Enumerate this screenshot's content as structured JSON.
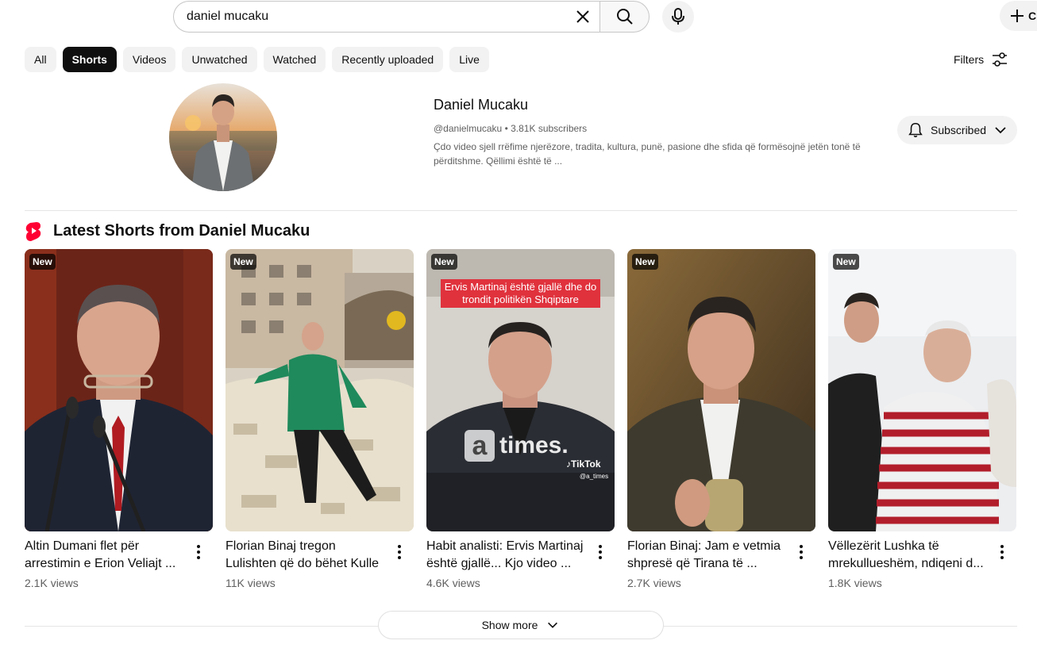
{
  "search": {
    "query": "daniel mucaku",
    "create_label": "C"
  },
  "chips": [
    "All",
    "Shorts",
    "Videos",
    "Unwatched",
    "Watched",
    "Recently uploaded",
    "Live"
  ],
  "active_chip": "Shorts",
  "filters_label": "Filters",
  "channel": {
    "name": "Daniel Mucaku",
    "handle": "@danielmucaku",
    "subscribers": "3.81K subscribers",
    "description": "Çdo video sjell rrëfime njerëzore, tradita, kultura, punë, pasione dhe sfida që formësojnë jetën tonë të përditshme. Qëllimi është të ...",
    "subscribe_label": "Subscribed"
  },
  "shelf": {
    "title": "Latest Shorts from Daniel Mucaku",
    "show_more": "Show more",
    "cards": [
      {
        "badge": "New",
        "title": "Altin Dumani flet për arrestimin e Erion Veliajt ...",
        "views": "2.1K views"
      },
      {
        "badge": "New",
        "title": "Florian Binaj tregon Lulishten që do bëhet Kulle",
        "views": "11K views"
      },
      {
        "badge": "New",
        "title": "Habit analisti: Ervis Martinaj është gjallë... Kjo video ...",
        "views": "4.6K views",
        "overlay_text": "Ervis Martinaj është gjallë dhe do trondit politikën Shqiptare",
        "watermark": "times.",
        "tiktok": "TikTok",
        "tiktok_handle": "@a_times"
      },
      {
        "badge": "New",
        "title": "Florian Binaj: Jam e vetmia shpresë që Tirana të ...",
        "views": "2.7K views"
      },
      {
        "badge": "New",
        "title": "Vëllezërit Lushka të mrekullueshëm, ndiqeni d...",
        "views": "1.8K views"
      }
    ]
  },
  "colors": {
    "shorts_red": "#ff0033",
    "chip_active": "#0f0f0f",
    "chip_bg": "#f2f2f2"
  }
}
